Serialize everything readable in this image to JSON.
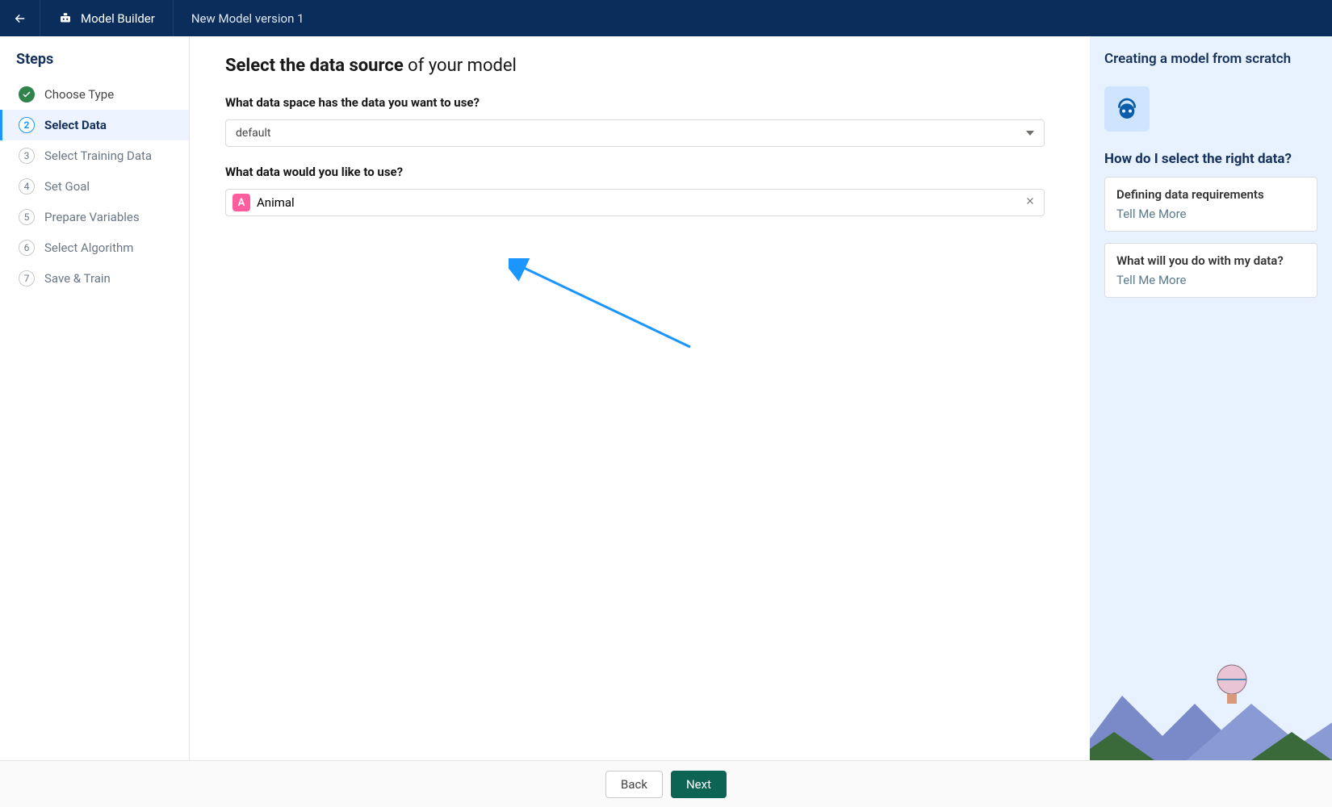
{
  "header": {
    "app_name": "Model Builder",
    "page_title": "New Model version 1"
  },
  "sidebar": {
    "heading": "Steps",
    "steps": [
      {
        "num": "",
        "label": "Choose Type",
        "state": "done"
      },
      {
        "num": "2",
        "label": "Select Data",
        "state": "active"
      },
      {
        "num": "3",
        "label": "Select Training Data",
        "state": ""
      },
      {
        "num": "4",
        "label": "Set Goal",
        "state": ""
      },
      {
        "num": "5",
        "label": "Prepare Variables",
        "state": ""
      },
      {
        "num": "6",
        "label": "Select Algorithm",
        "state": ""
      },
      {
        "num": "7",
        "label": "Save & Train",
        "state": ""
      }
    ]
  },
  "main": {
    "heading_bold": "Select the data source",
    "heading_rest": " of your model",
    "label1": "What data space has the data you want to use?",
    "selected_space": "default",
    "label2": "What data would you like to use?",
    "selected_data": "Animal",
    "tag_glyph": "A"
  },
  "help": {
    "title": "Creating a model from scratch",
    "subheading": "How do I select the right data?",
    "cards": [
      {
        "q": "Defining data requirements",
        "link": "Tell Me More"
      },
      {
        "q": "What will you do with my data?",
        "link": "Tell Me More"
      }
    ]
  },
  "footer": {
    "back": "Back",
    "next": "Next"
  }
}
